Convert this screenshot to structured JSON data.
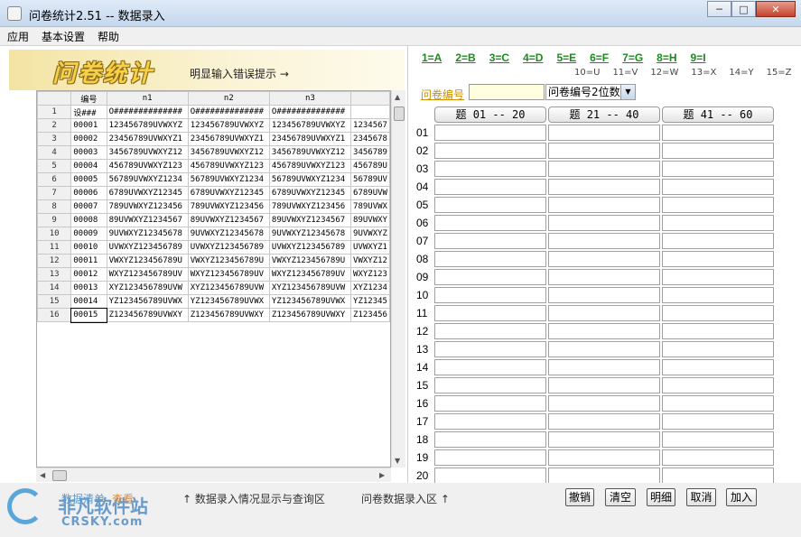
{
  "window": {
    "title": "问卷统计2.51 -- 数据录入",
    "min": "─",
    "max": "□",
    "close": "✕"
  },
  "menu": [
    "应用",
    "基本设置",
    "帮助"
  ],
  "banner": {
    "logo": "问卷统计",
    "hint": "明显输入错误提示 →"
  },
  "grid": {
    "headers": [
      "",
      "编号",
      "n1",
      "n2",
      "n3",
      ""
    ],
    "rows": [
      [
        "1",
        "设###",
        "O##############",
        "O##############",
        "O##############",
        ""
      ],
      [
        "2",
        "00001",
        "123456789UVWXYZ",
        "123456789UVWXYZ",
        "123456789UVWXYZ",
        "1234567"
      ],
      [
        "3",
        "00002",
        "23456789UVWXYZ1",
        "23456789UVWXYZ1",
        "23456789UVWXYZ1",
        "2345678"
      ],
      [
        "4",
        "00003",
        "3456789UVWXYZ12",
        "3456789UVWXYZ12",
        "3456789UVWXYZ12",
        "3456789"
      ],
      [
        "5",
        "00004",
        "456789UVWXYZ123",
        "456789UVWXYZ123",
        "456789UVWXYZ123",
        "456789U"
      ],
      [
        "6",
        "00005",
        "56789UVWXYZ1234",
        "56789UVWXYZ1234",
        "56789UVWXYZ1234",
        "56789UV"
      ],
      [
        "7",
        "00006",
        "6789UVWXYZ12345",
        "6789UVWXYZ12345",
        "6789UVWXYZ12345",
        "6789UVW"
      ],
      [
        "8",
        "00007",
        "789UVWXYZ123456",
        "789UVWXYZ123456",
        "789UVWXYZ123456",
        "789UVWX"
      ],
      [
        "9",
        "00008",
        "89UVWXYZ1234567",
        "89UVWXYZ1234567",
        "89UVWXYZ1234567",
        "89UVWXY"
      ],
      [
        "10",
        "00009",
        "9UVWXYZ12345678",
        "9UVWXYZ12345678",
        "9UVWXYZ12345678",
        "9UVWXYZ"
      ],
      [
        "11",
        "00010",
        "UVWXYZ123456789",
        "UVWXYZ123456789",
        "UVWXYZ123456789",
        "UVWXYZ1"
      ],
      [
        "12",
        "00011",
        "VWXYZ123456789U",
        "VWXYZ123456789U",
        "VWXYZ123456789U",
        "VWXYZ12"
      ],
      [
        "13",
        "00012",
        "WXYZ123456789UV",
        "WXYZ123456789UV",
        "WXYZ123456789UV",
        "WXYZ123"
      ],
      [
        "14",
        "00013",
        "XYZ123456789UVW",
        "XYZ123456789UVW",
        "XYZ123456789UVW",
        "XYZ1234"
      ],
      [
        "15",
        "00014",
        "YZ123456789UVWX",
        "YZ123456789UVWX",
        "YZ123456789UVWX",
        "YZ12345"
      ],
      [
        "16",
        "00015",
        "Z123456789UVWXY",
        "Z123456789UVWXY",
        "Z123456789UVWXY",
        "Z123456"
      ]
    ]
  },
  "keymap": [
    "1=A",
    "2=B",
    "3=C",
    "4=D",
    "5=E",
    "6=F",
    "7=G",
    "8=H",
    "9=I"
  ],
  "keymap2": [
    "10=U",
    "11=V",
    "12=W",
    "13=X",
    "14=Y",
    "15=Z"
  ],
  "entry": {
    "label": "问卷编号",
    "input_value": "",
    "select": "问卷编号2位数",
    "columns": [
      "题 01 -- 20",
      "题 21 -- 40",
      "题 41 -- 60"
    ],
    "row_labels": [
      "01",
      "02",
      "03",
      "04",
      "05",
      "06",
      "07",
      "08",
      "09",
      "10",
      "11",
      "12",
      "13",
      "14",
      "15",
      "16",
      "17",
      "18",
      "19",
      "20"
    ]
  },
  "bottom": {
    "left_label": "数据清单",
    "left_label2": "查看",
    "note1": "↑ 数据录入情况显示与查询区",
    "note2": "问卷数据录入区 ↑",
    "buttons": [
      "撤销",
      "清空",
      "明细",
      "取消",
      "加入"
    ]
  },
  "watermark": {
    "text": "非凡软件站",
    "sub": "CRSKY.com"
  }
}
